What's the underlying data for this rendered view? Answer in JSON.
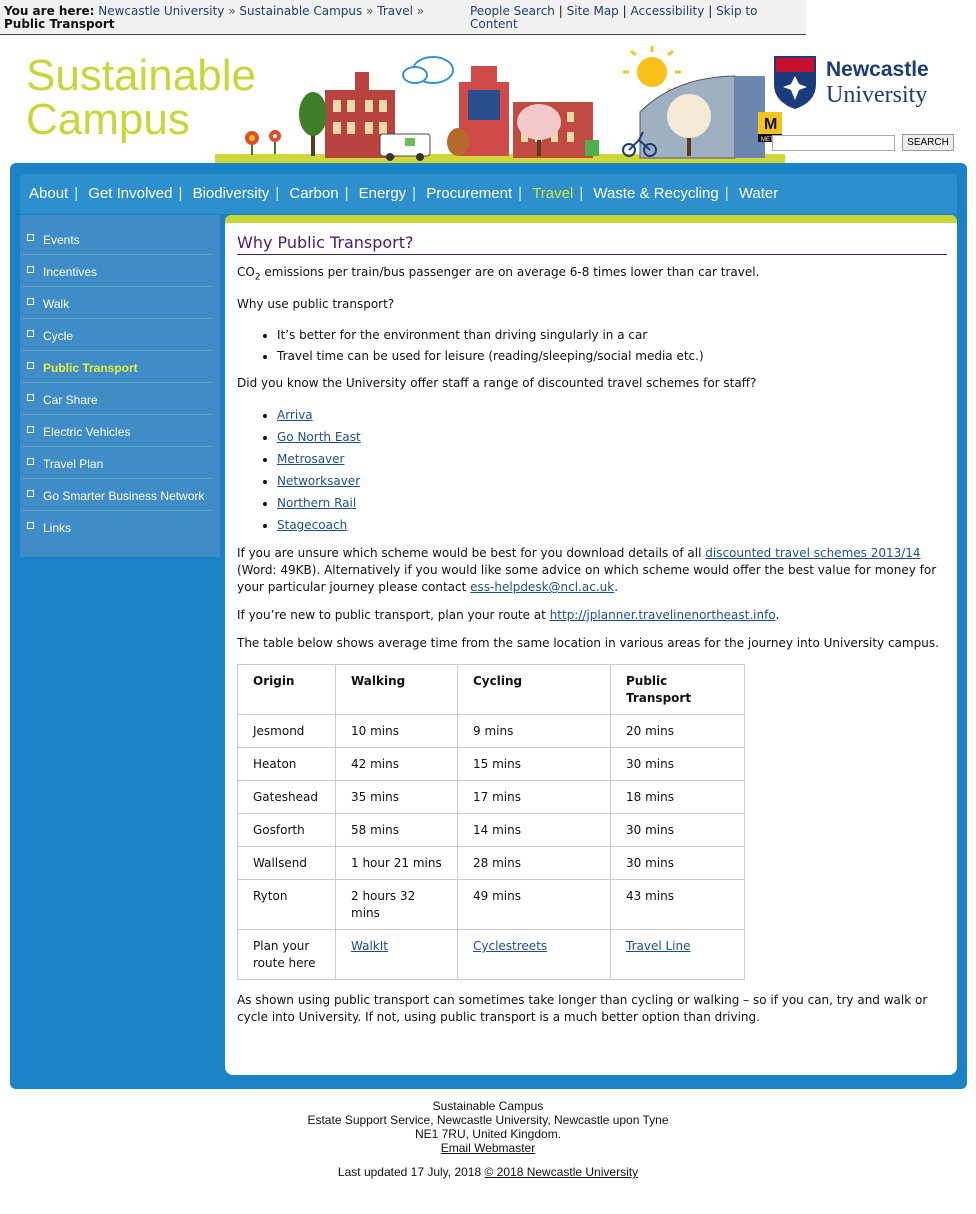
{
  "topbar": {
    "you_are_here": "You are here:",
    "crumbs": [
      "Newcastle University",
      "Sustainable Campus",
      "Travel"
    ],
    "separator": "»",
    "current": "Public Transport",
    "quick_links": [
      "People Search",
      "Site Map",
      "Accessibility",
      "Skip to Content"
    ],
    "quick_sep": "|"
  },
  "header": {
    "site_title_line1": "Sustainable",
    "site_title_line2": "Campus",
    "uni_name_line1": "Newcastle",
    "uni_name_line2": "University",
    "search_button": "SEARCH",
    "banner_sign": "M",
    "banner_sign_sub": "METRO"
  },
  "nav": {
    "items": [
      "About",
      "Get Involved",
      "Biodiversity",
      "Carbon",
      "Energy",
      "Procurement",
      "Travel",
      "Waste & Recycling",
      "Water"
    ],
    "active": "Travel",
    "sep": "|"
  },
  "sidebar": {
    "items": [
      "Events",
      "Incentives",
      "Walk",
      "Cycle",
      "Public Transport",
      "Car Share",
      "Electric Vehicles",
      "Travel Plan",
      "Go Smarter Business Network",
      "Links"
    ],
    "active": "Public Transport"
  },
  "content": {
    "title": "Why Public Transport?",
    "co2_prefix": "CO",
    "co2_sub": "2",
    "co2_rest": " emissions per train/bus passenger are on average 6-8 times lower than car travel.",
    "why_heading": "Why use public transport?",
    "why_bullets": [
      "It’s better for the environment than driving singularly in a car",
      "Travel time can be used for leisure (reading/sleeping/social media etc.)"
    ],
    "schemes_intro": "Did you know the University offer staff a range of discounted travel schemes for staff?",
    "schemes": [
      "Arriva",
      "Go North East",
      "Metrosaver",
      "Networksaver",
      "Northern Rail",
      "Stagecoach"
    ],
    "unsure_1": "If you are unsure which scheme would be best for you download details of all ",
    "unsure_link": "discounted travel schemes 2013/14",
    "unsure_2": " (Word: 49KB). Alternatively if you would like some advice on which scheme would offer the best value for money for your particular journey please contact ",
    "unsure_email": "ess-helpdesk@ncl.ac.uk",
    "unsure_3": ".",
    "planner_1": "If you’re new to public transport, plan your route at ",
    "planner_link": "http://jplanner.travelinenortheast.info",
    "planner_2": ".",
    "table_intro": "The table below shows average time from the same location in various areas for the journey into University campus.",
    "table": {
      "headers": [
        "Origin",
        "Walking",
        "Cycling",
        "Public Transport"
      ],
      "rows": [
        [
          "Jesmond",
          "10 mins",
          "9 mins",
          "20 mins"
        ],
        [
          "Heaton",
          "42 mins",
          "15 mins",
          "30 mins"
        ],
        [
          "Gateshead",
          "35 mins",
          "17 mins",
          "18 mins"
        ],
        [
          "Gosforth",
          "58 mins",
          "14 mins",
          "30 mins"
        ],
        [
          "Wallsend",
          "1 hour 21 mins",
          "28 mins",
          "30 mins"
        ],
        [
          "Ryton",
          "2 hours 32 mins",
          "49 mins",
          "43 mins"
        ]
      ],
      "plan_row": [
        "Plan your route here",
        "WalkIt",
        "Cyclestreets",
        "Travel Line"
      ]
    },
    "closing": "As shown using public transport can sometimes take longer than cycling or walking – so if you can, try and walk or cycle into University. If not, using public transport is a much better option than driving."
  },
  "footer": {
    "line1": "Sustainable Campus",
    "line2": "Estate Support Service, Newcastle University, Newcastle upon Tyne",
    "line3": "NE1 7RU, United Kingdom.",
    "webmaster": "Email Webmaster",
    "updated": "Last updated 17 July, 2018",
    "copyright": "© 2018 Newcastle University"
  },
  "colors": {
    "brand_blue": "#1b82c5",
    "lime": "#c5d636",
    "title_purple": "#4d1c6c",
    "uni_navy": "#1b3b7a"
  }
}
